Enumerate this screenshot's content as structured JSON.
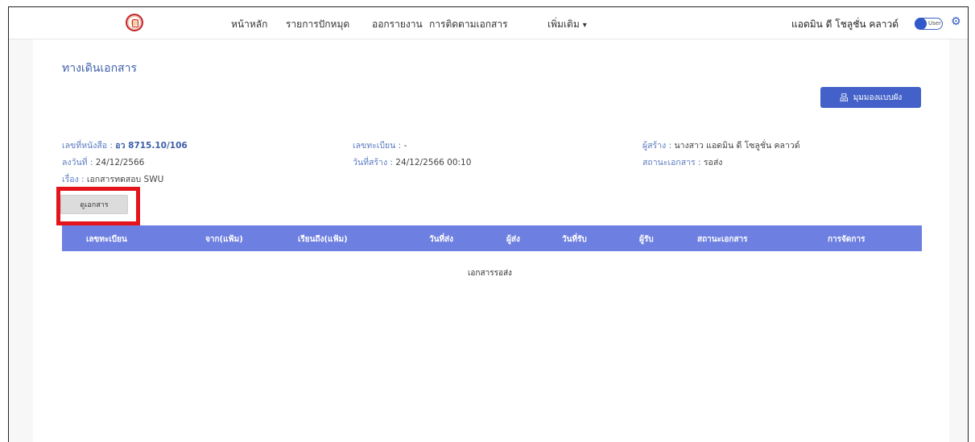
{
  "navbar": {
    "items": [
      {
        "label": "หน้าหลัก"
      },
      {
        "label": "รายการปักหมุด"
      },
      {
        "label": "ออกรายงาน"
      },
      {
        "label": "การติดตามเอกสาร"
      },
      {
        "label": "เพิ่มเติม"
      }
    ],
    "more_icon": "chevron-down-icon",
    "user_name": "แอดมิน ดี โชลูชั่น คลาวด์",
    "toggle_label": "User",
    "settings_icon": "gear-icon"
  },
  "page": {
    "title": "ทางเดินเอกสาร",
    "flow_button_label": "มุมมองแบบผัง",
    "flow_button_icon": "sitemap-icon"
  },
  "document": {
    "doc_no_label": "เลขที่หนังสือ : ",
    "doc_no_value": "อว 8715.10/106",
    "date_label": "ลงวันที่ : ",
    "date_value": "24/12/2566",
    "subject_label": "เรื่อง : ",
    "subject_value": "เอกสารทดสอบ SWU",
    "reg_label": "เลขทะเบียน : ",
    "reg_value": "-",
    "created_label": "วันที่สร้าง : ",
    "created_value": "24/12/2566 00:10",
    "creator_label": "ผู้สร้าง : ",
    "creator_value": "นางสาว แอดมิน ดี โซลูชั่น คลาวด์",
    "status_label": "สถานะเอกสาร : ",
    "status_value": "รอส่ง",
    "view_button_label": "ดูเอกสาร"
  },
  "table": {
    "columns": [
      "เลขทะเบียน",
      "จาก(แฟ้ม)",
      "เรียนถึง(แฟ้ม)",
      "วันที่ส่ง",
      "ผู้ส่ง",
      "วันที่รับ",
      "ผู้รับ",
      "สถานะเอกสาร",
      "การจัดการ"
    ],
    "empty_message": "เอกสารรอส่ง"
  },
  "colors": {
    "accent": "#4361c8",
    "table_header": "#6d7fe0",
    "highlight": "#e3151b"
  }
}
